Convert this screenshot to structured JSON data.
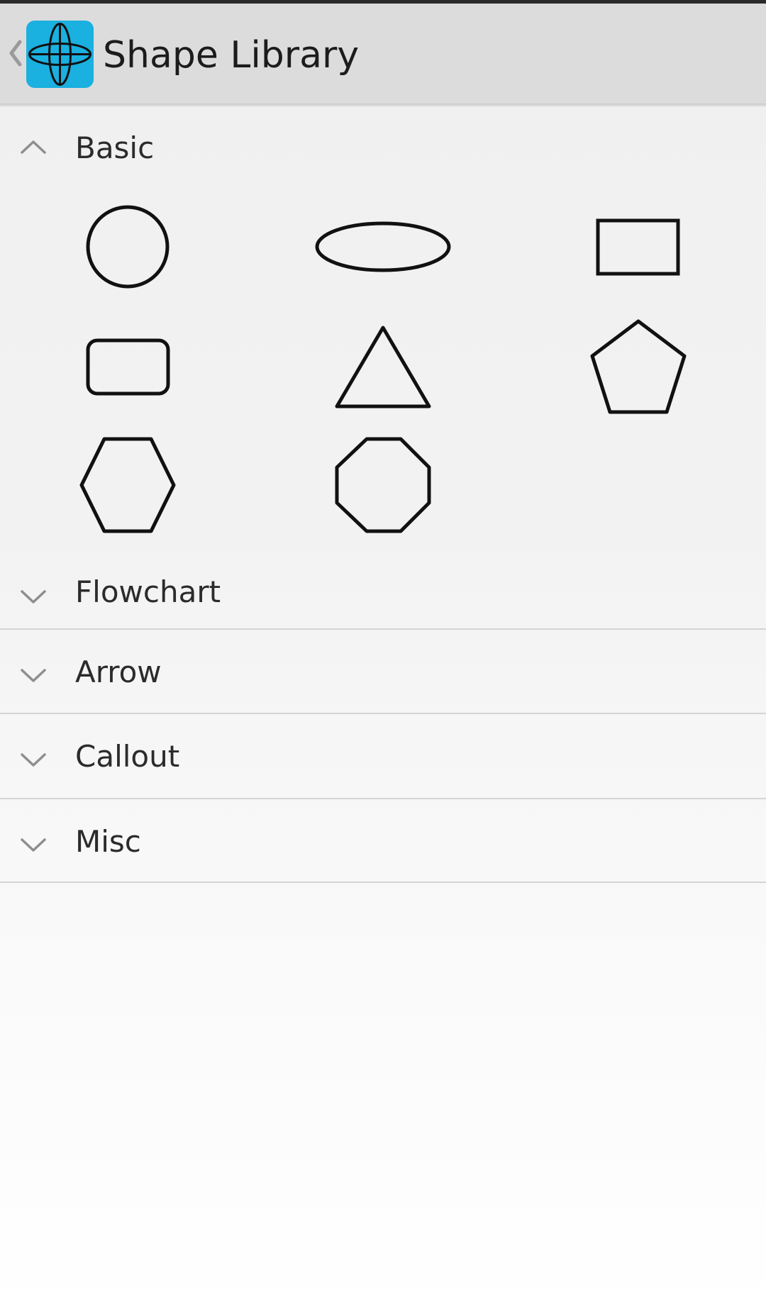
{
  "header": {
    "title": "Shape Library",
    "up_icon": "back-caret-icon",
    "app_icon": "shape-library-app-icon",
    "app_icon_color": "#1ab0e0"
  },
  "sections": [
    {
      "label": "Basic",
      "expanded": true,
      "shapes": [
        "circle",
        "ellipse",
        "rectangle",
        "rounded-rectangle",
        "triangle",
        "pentagon",
        "hexagon",
        "octagon"
      ]
    },
    {
      "label": "Flowchart",
      "expanded": false
    },
    {
      "label": "Arrow",
      "expanded": false
    },
    {
      "label": "Callout",
      "expanded": false
    },
    {
      "label": "Misc",
      "expanded": false
    }
  ]
}
